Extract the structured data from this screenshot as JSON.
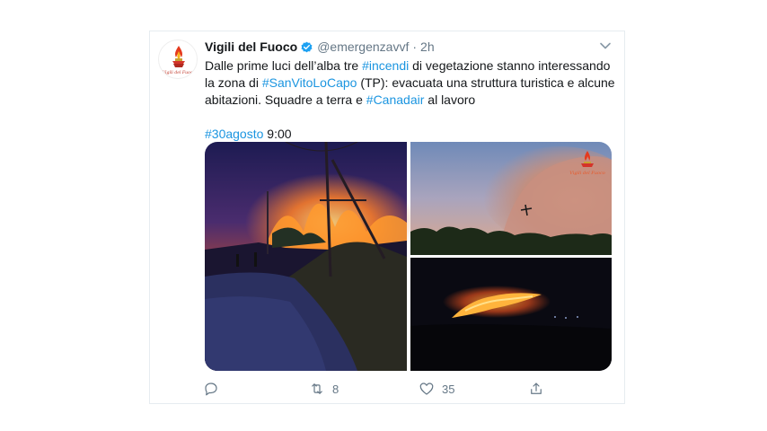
{
  "account": {
    "name": "Vigili del Fuoco",
    "handle": "@emergenzavvf",
    "separator": "·",
    "time": "2h",
    "avatar_logo_text": "Vigili del Fuoco",
    "verified": true
  },
  "tweet": {
    "line1": {
      "before": "Dalle prime luci dell’alba tre ",
      "tag": "#incendi",
      "after": " di vegetazione stanno interessando"
    },
    "line2": {
      "before": "la zona di ",
      "tag": "#SanVitoLoCapo",
      "after": " (TP): evacuata una struttura turistica e alcune"
    },
    "line3": {
      "before": "abitazioni. Squadre a terra e ",
      "tag": "#Canadair",
      "after": " al lavoro"
    },
    "line4": {
      "tag": "#30agosto",
      "after": " 9:00"
    }
  },
  "media": {
    "photos": [
      "night-fire-road",
      "smoke-plane-canadair",
      "night-fire-hill"
    ],
    "watermark_text": "Vigili del Fuoco"
  },
  "actions": {
    "reply_count": "",
    "retweet_count": "8",
    "like_count": "35"
  },
  "colors": {
    "link": "#1b95e0",
    "text": "#14171a",
    "muted": "#657786",
    "border": "#e6ecf0",
    "verified": "#1da1f2"
  },
  "icons": [
    "verified-badge-icon",
    "chevron-down-icon",
    "reply-icon",
    "retweet-icon",
    "like-icon",
    "share-icon",
    "firefighter-logo-icon"
  ]
}
